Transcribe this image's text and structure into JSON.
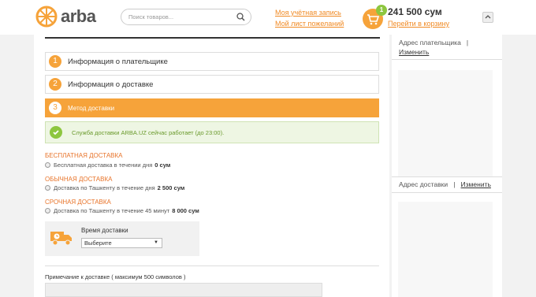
{
  "header": {
    "logo_text": "arba",
    "search_placeholder": "Поиск товаров...",
    "account_link": "Моя учётная запись",
    "wishlist_link": "Мой лист пожеланий",
    "cart_count": "1",
    "cart_total": "241 500 сум",
    "cart_link": "Перейти в корзину"
  },
  "steps": [
    {
      "num": "1",
      "label": "Информация о плательщике"
    },
    {
      "num": "2",
      "label": "Информация о доставке"
    },
    {
      "num": "3",
      "label": "Метод доставки"
    }
  ],
  "notice": {
    "text": "Служба доставки ARBA.UZ сейчас работает (до 23:00)."
  },
  "shipping": [
    {
      "title": "БЕСПЛАТНАЯ ДОСТАВКА",
      "option": "Бесплатная доставка в течении дня",
      "price": "0 сум"
    },
    {
      "title": "ОБЫЧНАЯ ДОСТАВКА",
      "option": "Доставка по Ташкенту в течение дня",
      "price": "2 500 сум"
    },
    {
      "title": "СРОЧНАЯ ДОСТАВКА",
      "option": "Доставка по Ташкенту в течение 45 минут",
      "price": "8 000 сум"
    }
  ],
  "delivery_time": {
    "label": "Время доставки",
    "selected": "Выберите"
  },
  "note": {
    "label": "Примечание к доставке ( максимум 500 символов )"
  },
  "sidebar": {
    "billing_label": "Адрес плательщика",
    "separator": "|",
    "billing_edit": "Изменить",
    "shipping_label": "Адрес доставки",
    "shipping_edit": "Изменить"
  },
  "colors": {
    "accent": "#f6a33a",
    "link": "#f08a24",
    "success": "#8dc63f"
  }
}
